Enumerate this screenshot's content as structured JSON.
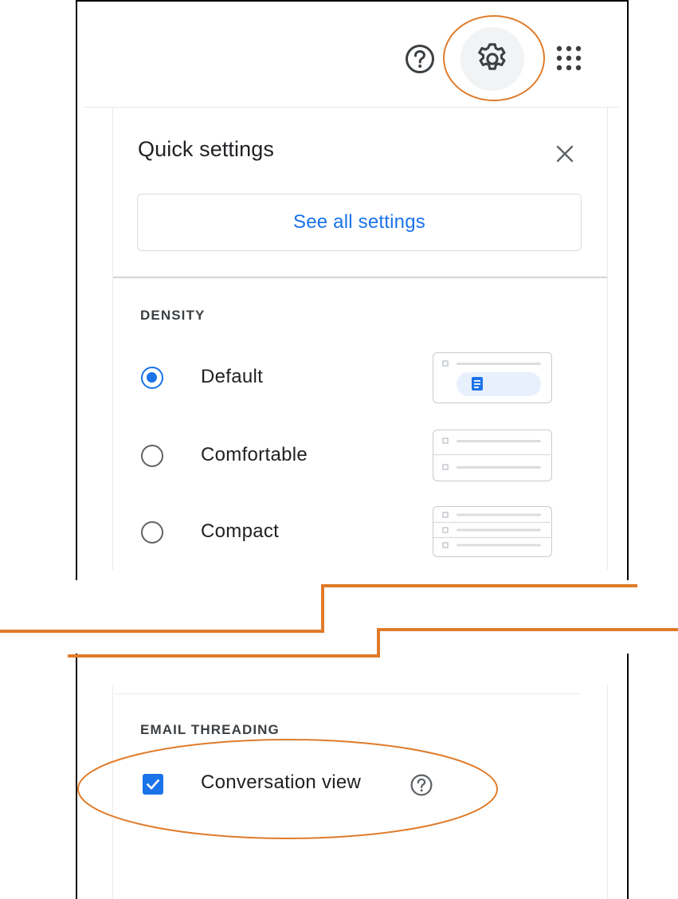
{
  "toolbar": {
    "help_icon": "help-circle-icon",
    "settings_icon": "gear-icon",
    "apps_icon": "apps-grid-icon"
  },
  "quick_settings": {
    "title": "Quick settings",
    "close_icon": "close-icon",
    "see_all_label": "See all settings"
  },
  "density": {
    "title": "DENSITY",
    "options": [
      {
        "label": "Default",
        "selected": true
      },
      {
        "label": "Comfortable",
        "selected": false
      },
      {
        "label": "Compact",
        "selected": false
      }
    ]
  },
  "email_threading": {
    "title": "EMAIL THREADING",
    "conversation_view_label": "Conversation view",
    "conversation_view_checked": true,
    "help_icon": "help-circle-icon"
  },
  "colors": {
    "accent": "#1a73e8",
    "annotation": "#e07b2a",
    "text": "#202124",
    "border": "#dadce0"
  }
}
